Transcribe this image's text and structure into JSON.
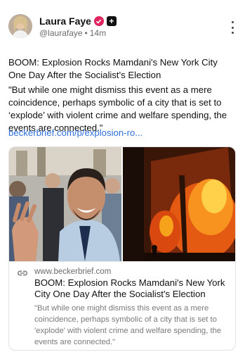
{
  "author": {
    "name": "Laura Faye",
    "handle": "@laurafaye",
    "separator": "•",
    "time": "14m",
    "verified_icon": "verified-check-icon",
    "badge_icon": "plus-badge-icon",
    "badge_text": "+"
  },
  "post": {
    "title": "BOOM: Explosion Rocks Mamdani's New York City One Day After the Socialist's Election",
    "quote": "\"But while one might dismiss this event as a mere coincidence, perhaps symbolic of a city that is set to ‘explode’ with violent crime and welfare spending, the events are connected.\"",
    "link_text": "beckerbrief.com/p/explosion-ro..."
  },
  "link_card": {
    "domain": "www.beckerbrief.com",
    "title": "BOOM: Explosion Rocks Mamdani's New York City One Day After the Socialist's Election",
    "description": "\"But while one might dismiss this event as a mere coincidence, perhaps symbolic of a city that is set to 'explode' with violent crime and welfare spending, the events are connected.\"",
    "icon": "link-icon"
  },
  "colors": {
    "link": "#2f6fdb",
    "verified": "#e0245e",
    "muted": "#6b6b6b"
  }
}
